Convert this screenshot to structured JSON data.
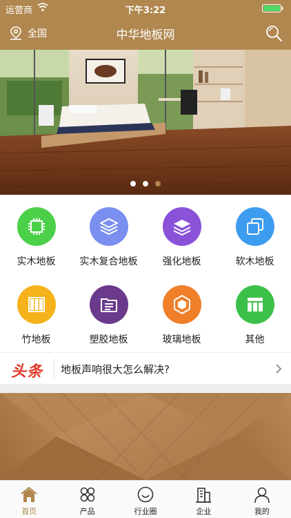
{
  "status_bar": {
    "carrier": "运营商",
    "time": "下午3:22"
  },
  "nav": {
    "location": "全国",
    "title": "中华地板网"
  },
  "banner": {
    "dot_count": 3,
    "active_dot": 2
  },
  "categories": [
    {
      "label": "实木地板",
      "icon": "chip-icon",
      "color": "#4cd04a"
    },
    {
      "label": "实木复合地板",
      "icon": "layers-icon",
      "color": "#7b8ff0"
    },
    {
      "label": "强化地板",
      "icon": "stack-icon",
      "color": "#8a52d8"
    },
    {
      "label": "软木地板",
      "icon": "copy-icon",
      "color": "#3e9cf0"
    },
    {
      "label": "竹地板",
      "icon": "columns-icon",
      "color": "#f5b21b"
    },
    {
      "label": "塑胶地板",
      "icon": "document-icon",
      "color": "#6b3a8c"
    },
    {
      "label": "玻璃地板",
      "icon": "hexagon-icon",
      "color": "#ef7f29"
    },
    {
      "label": "其他",
      "icon": "table-icon",
      "color": "#3cc04a"
    }
  ],
  "headline": {
    "tag": "头条",
    "text": "地板声响很大怎么解决?"
  },
  "tabs": [
    {
      "label": "首页",
      "icon": "home-icon",
      "active": true
    },
    {
      "label": "产品",
      "icon": "grid-icon",
      "active": false
    },
    {
      "label": "行业圈",
      "icon": "smile-icon",
      "active": false
    },
    {
      "label": "企业",
      "icon": "building-icon",
      "active": false
    },
    {
      "label": "我的",
      "icon": "user-icon",
      "active": false
    }
  ],
  "colors": {
    "brand": "#b0874f",
    "headline_tag": "#e4382b"
  }
}
